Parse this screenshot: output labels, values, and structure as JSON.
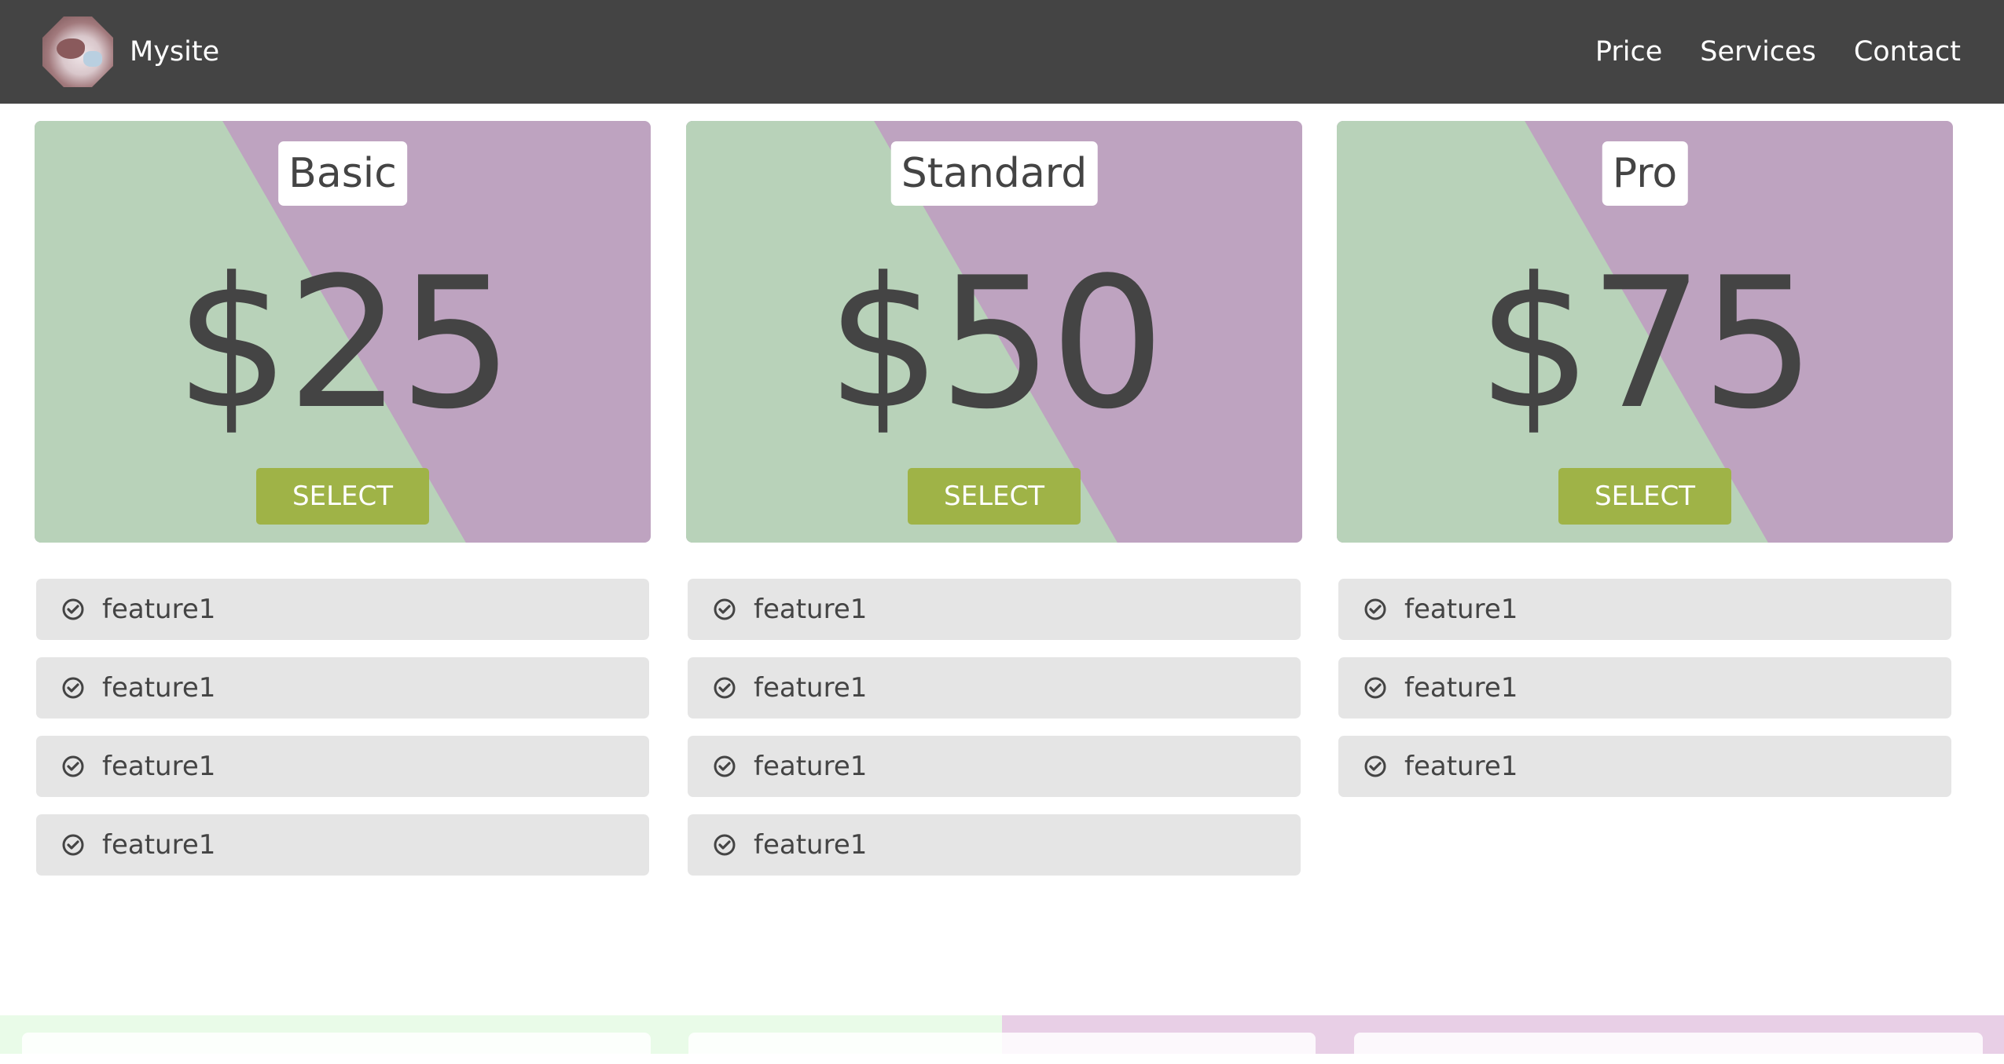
{
  "header": {
    "brand": "Mysite",
    "nav": [
      "Price",
      "Services",
      "Contact"
    ]
  },
  "plans": [
    {
      "name": "Basic",
      "price": "$25",
      "select_label": "SELECT",
      "features": [
        "feature1",
        "feature1",
        "feature1",
        "feature1"
      ]
    },
    {
      "name": "Standard",
      "price": "$50",
      "select_label": "SELECT",
      "features": [
        "feature1",
        "feature1",
        "feature1",
        "feature1"
      ]
    },
    {
      "name": "Pro",
      "price": "$75",
      "select_label": "SELECT",
      "features": [
        "feature1",
        "feature1",
        "feature1"
      ]
    }
  ],
  "icons": {
    "feature": "check-circle-icon",
    "logo": "avatar-logo"
  },
  "colors": {
    "header_bg": "#444444",
    "card_green": "#b8d2b9",
    "card_purple": "#bea3c0",
    "select_button": "#9fb347",
    "feature_bg": "#e5e5e5"
  }
}
